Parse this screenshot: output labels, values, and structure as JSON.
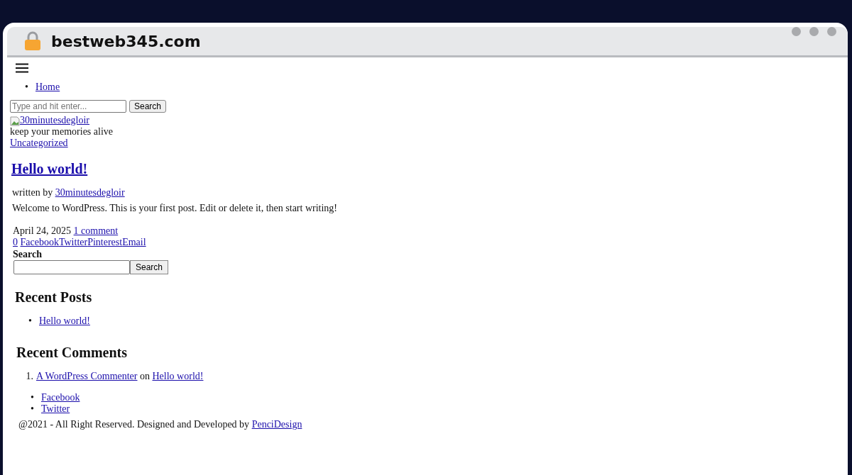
{
  "address_bar": {
    "url": "bestweb345.com"
  },
  "nav": {
    "items": [
      {
        "marker": "•",
        "label": "Home"
      }
    ]
  },
  "header_search": {
    "placeholder": "Type and hit enter...",
    "button": "Search"
  },
  "logo": {
    "alt": "30minutesdegloir"
  },
  "tagline": "keep your memories alive",
  "post": {
    "category": "Uncategorized",
    "title": "Hello world!",
    "byline": "written by",
    "author": "30minutesdegloir",
    "excerpt": "Welcome to WordPress. This is your first post. Edit or delete it, then start writing!",
    "date": "April 24, 2025",
    "comments": "1 comment",
    "share_count": "0",
    "share_links": [
      "Facebook",
      "Twitter",
      "Pinterest",
      "Email"
    ]
  },
  "sidebar": {
    "search": {
      "label": "Search",
      "button": "Search"
    },
    "recent_posts": {
      "title": "Recent Posts",
      "items": [
        {
          "marker": "•",
          "label": "Hello world!"
        }
      ]
    },
    "recent_comments": {
      "title": "Recent Comments",
      "items": [
        {
          "marker": "1.",
          "author": "A WordPress Commenter",
          "joiner": "on",
          "post": "Hello world!"
        }
      ]
    },
    "social": [
      {
        "marker": "•",
        "label": "Facebook"
      },
      {
        "marker": "•",
        "label": "Twitter"
      }
    ]
  },
  "footer": {
    "text": "@2021 - All Right Reserved. Designed and Developed by",
    "link": "PenciDesign"
  }
}
